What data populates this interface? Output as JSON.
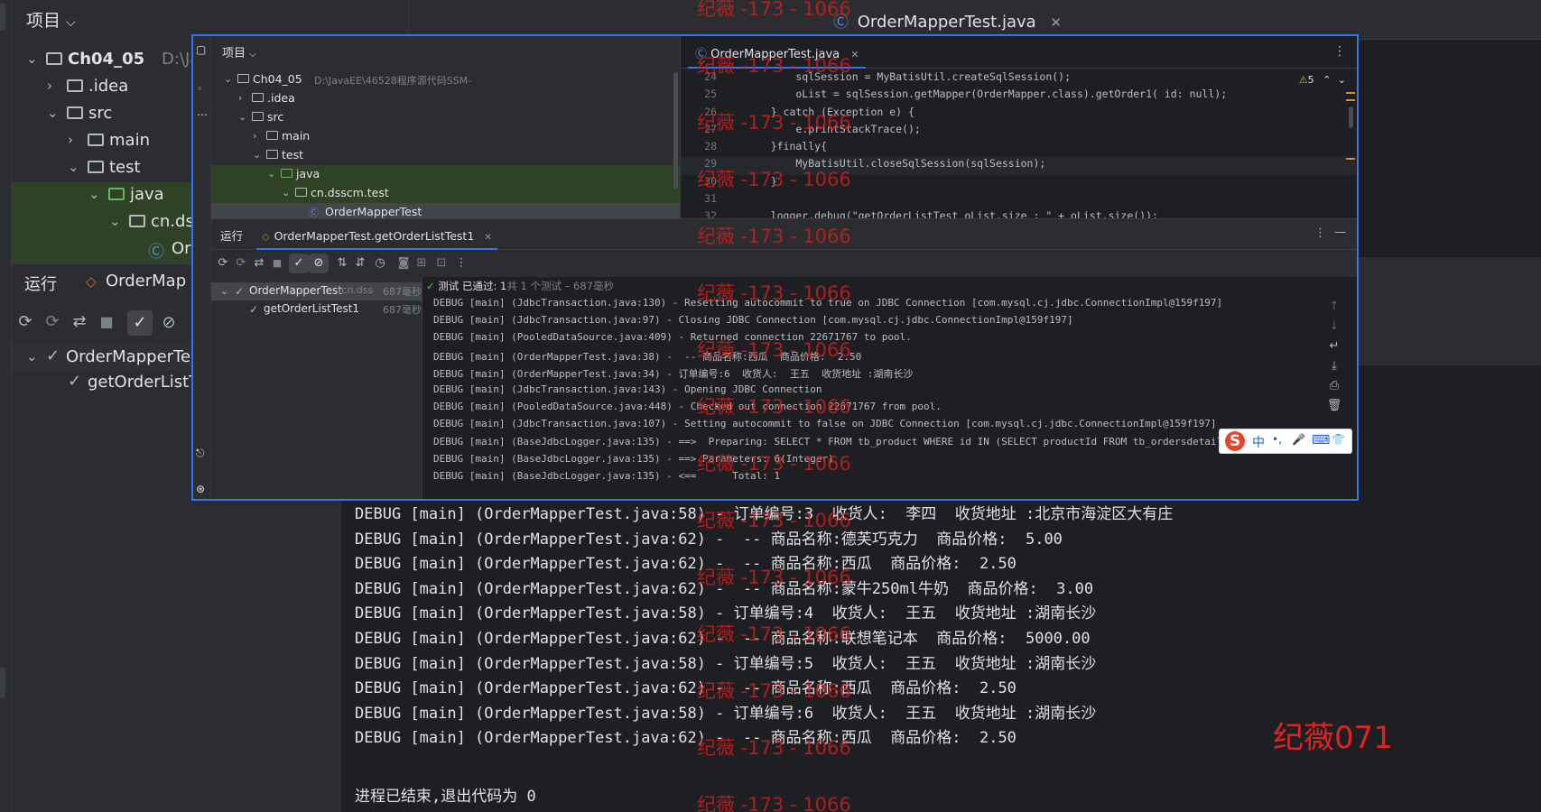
{
  "background_window": {
    "project_title": "项目",
    "tree": [
      {
        "label": "Ch04_05",
        "path": "D:\\Ja",
        "level": 0,
        "arrow": "down",
        "kind": "module",
        "bold": true
      },
      {
        "label": ".idea",
        "level": 1,
        "arrow": "right",
        "kind": "folder"
      },
      {
        "label": "src",
        "level": 1,
        "arrow": "down",
        "kind": "folder"
      },
      {
        "label": "main",
        "level": 2,
        "arrow": "right",
        "kind": "folder"
      },
      {
        "label": "test",
        "level": 2,
        "arrow": "down",
        "kind": "folder"
      },
      {
        "label": "java",
        "level": 3,
        "arrow": "down",
        "kind": "test-folder",
        "highlight": true
      },
      {
        "label": "cn.ds",
        "level": 4,
        "arrow": "down",
        "kind": "package",
        "highlight": true
      },
      {
        "label": "Or",
        "level": 5,
        "arrow": "",
        "kind": "class",
        "highlight": true
      }
    ],
    "run_title": "运行",
    "run_tab": "OrderMap",
    "run_tree": [
      {
        "label": "OrderMapperTe",
        "level": 0
      },
      {
        "label": "getOrderListT",
        "level": 1
      }
    ],
    "editor_tab": "OrderMapperTest.java",
    "console_lines": [
      "DEBUG [main] (OrderMapperTest.java:58) - 订单编号:3  收货人:  李四  收货地址 :北京市海淀区大有庄",
      "DEBUG [main] (OrderMapperTest.java:62) -  -- 商品名称:德芙巧克力  商品价格:  5.00",
      "DEBUG [main] (OrderMapperTest.java:62) -  -- 商品名称:西瓜  商品价格:  2.50",
      "DEBUG [main] (OrderMapperTest.java:62) -  -- 商品名称:蒙牛250ml牛奶  商品价格:  3.00",
      "DEBUG [main] (OrderMapperTest.java:58) - 订单编号:4  收货人:  王五  收货地址 :湖南长沙",
      "DEBUG [main] (OrderMapperTest.java:62) -  -- 商品名称:联想笔记本  商品价格:  5000.00",
      "DEBUG [main] (OrderMapperTest.java:58) - 订单编号:5  收货人:  王五  收货地址 :湖南长沙",
      "DEBUG [main] (OrderMapperTest.java:62) -  -- 商品名称:西瓜  商品价格:  2.50",
      "DEBUG [main] (OrderMapperTest.java:58) - 订单编号:6  收货人:  王五  收货地址 :湖南长沙",
      "DEBUG [main] (OrderMapperTest.java:62) -  -- 商品名称:西瓜  商品价格:  2.50"
    ],
    "exit_message": "进程已结束,退出代码为 0"
  },
  "foreground_window": {
    "project_title": "项目",
    "tree": [
      {
        "label": "Ch04_05",
        "path": "D:\\JavaEE\\46528程序源代码SSM-",
        "level": 0,
        "arrow": "down",
        "kind": "module"
      },
      {
        "label": ".idea",
        "level": 1,
        "arrow": "right",
        "kind": "folder"
      },
      {
        "label": "src",
        "level": 1,
        "arrow": "down",
        "kind": "folder"
      },
      {
        "label": "main",
        "level": 2,
        "arrow": "right",
        "kind": "folder"
      },
      {
        "label": "test",
        "level": 2,
        "arrow": "down",
        "kind": "folder"
      },
      {
        "label": "java",
        "level": 3,
        "arrow": "down",
        "kind": "test-folder",
        "highlight": true
      },
      {
        "label": "cn.dsscm.test",
        "level": 4,
        "arrow": "down",
        "kind": "package",
        "highlight": true
      },
      {
        "label": "OrderMapperTest",
        "level": 5,
        "arrow": "",
        "kind": "class",
        "highlight": true,
        "selected": true
      }
    ],
    "editor_tab": "OrderMapperTest.java",
    "warning_count": "5",
    "code_lines": [
      {
        "n": "24",
        "text": "        sqlSession = MyBatisUtil.createSqlSession();"
      },
      {
        "n": "25",
        "text": "        oList = sqlSession.getMapper(OrderMapper.class).getOrder1( id: null);"
      },
      {
        "n": "26",
        "text": "    } catch (Exception e) {"
      },
      {
        "n": "27",
        "text": "        e.printStackTrace();"
      },
      {
        "n": "28",
        "text": "    }finally{"
      },
      {
        "n": "29",
        "text": "        MyBatisUtil.closeSqlSession(sqlSession);",
        "current": true
      },
      {
        "n": "30",
        "text": "    }"
      },
      {
        "n": "31",
        "text": ""
      },
      {
        "n": "32",
        "text": "    logger.debug(\"getOrderListTest oList.size : \" + oList.size());"
      }
    ],
    "run_title": "运行",
    "run_tab": "OrderMapperTest.getOrderListTest1",
    "run_tree": [
      {
        "label": "OrderMapperTest",
        "detail": "(cn.dss",
        "time": "687毫秒",
        "level": 0
      },
      {
        "label": "getOrderListTest1",
        "detail": "",
        "time": "687毫秒",
        "level": 1
      }
    ],
    "status_prefix": "测试 已通过: 1",
    "status_suffix": "共 1 个测试 – 687毫秒",
    "log_lines": [
      "DEBUG [main] (JdbcTransaction.java:130) - Resetting autocommit to true on JDBC Connection [com.mysql.cj.jdbc.ConnectionImpl@159f197]",
      "DEBUG [main] (JdbcTransaction.java:97) - Closing JDBC Connection [com.mysql.cj.jdbc.ConnectionImpl@159f197]",
      "DEBUG [main] (PooledDataSource.java:409) - Returned connection 22671767 to pool.",
      "DEBUG [main] (OrderMapperTest.java:38) -  -- 商品名称:西瓜  商品价格:  2.50",
      "DEBUG [main] (OrderMapperTest.java:34) - 订单编号:6  收货人:  王五  收货地址 :湖南长沙",
      "DEBUG [main] (JdbcTransaction.java:143) - Opening JDBC Connection",
      "DEBUG [main] (PooledDataSource.java:448) - Checked out connection 22671767 from pool.",
      "DEBUG [main] (JdbcTransaction.java:107) - Setting autocommit to false on JDBC Connection [com.mysql.cj.jdbc.ConnectionImpl@159f197]",
      "DEBUG [main] (BaseJdbcLogger.java:135) - ==>  Preparing: SELECT * FROM tb_product WHERE id IN (SELECT productId FROM tb_ordersdetail WHERE o",
      "DEBUG [main] (BaseJdbcLogger.java:135) - ==> Parameters: 6(Integer)",
      "DEBUG [main] (BaseJdbcLogger.java:135) - <==      Total: 1"
    ]
  },
  "ime_bar": {
    "logo": "S",
    "mode": "中",
    "punct": "•,",
    "mic": "🎤",
    "keyboard": "⌨",
    "skin": "👕"
  },
  "watermark": "纪薇 -173 - 1066",
  "watermark_big": "纪薇071",
  "colors": {
    "accent": "#3574f0",
    "success": "#5fb865",
    "watermark": "#d42020",
    "bg": "#1e1f22",
    "panel": "#2b2d30"
  }
}
